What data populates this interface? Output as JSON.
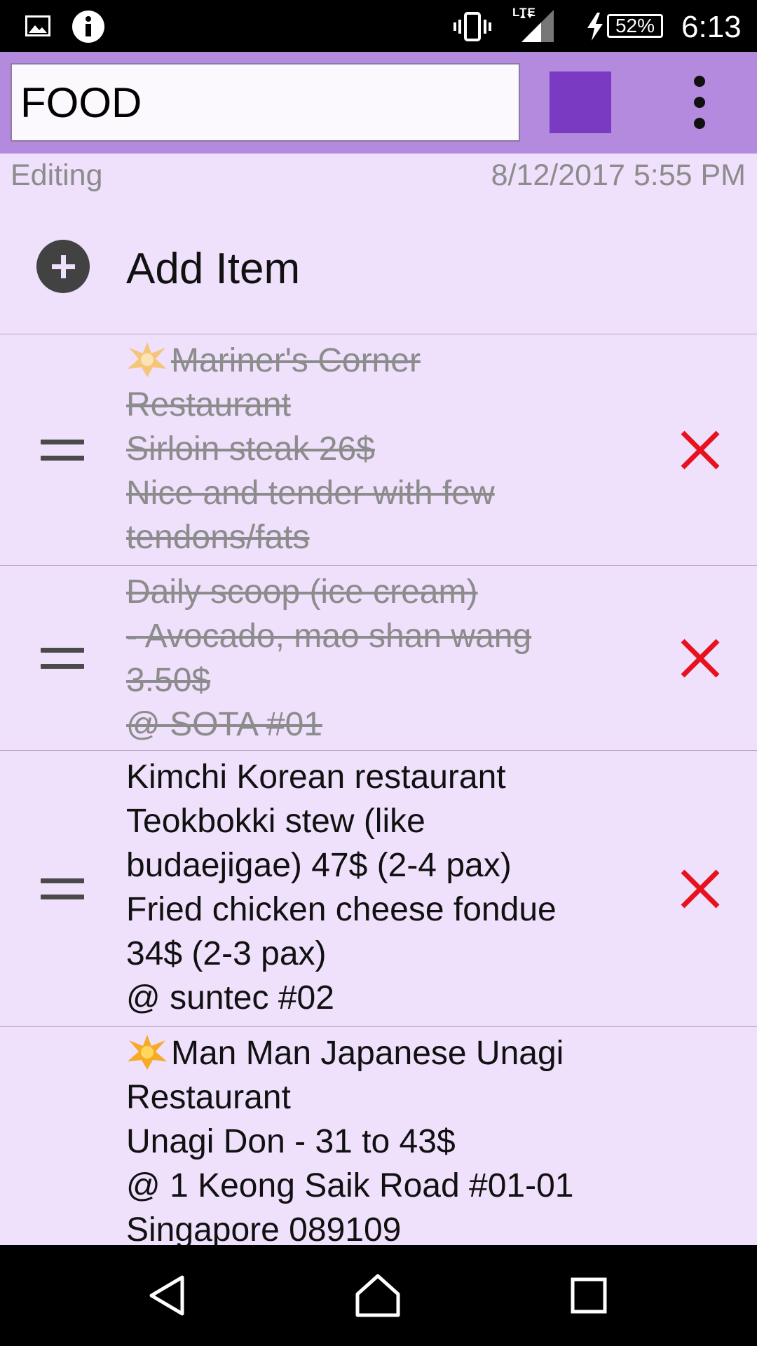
{
  "status_bar": {
    "network": "LTE",
    "battery": "52%",
    "time": "6:13",
    "icons": [
      "gallery-icon",
      "info-icon",
      "vibrate-icon",
      "signal-icon",
      "charging-icon",
      "battery-icon"
    ]
  },
  "toolbar": {
    "title_value": "FOOD",
    "color": "#7b3ac2"
  },
  "meta": {
    "status": "Editing",
    "date": "8/12/2017 5:55 PM"
  },
  "add_item": {
    "label": "Add Item"
  },
  "items": [
    {
      "star": true,
      "done": true,
      "text": "Mariner's Corner\nRestaurant\nSirloin steak 26$\nNice and tender with few\ntendons/fats"
    },
    {
      "star": false,
      "done": true,
      "text": "Daily scoop (ice cream)\n- Avocado, mao shan wang\n3.50$\n@ SOTA #01"
    },
    {
      "star": false,
      "done": false,
      "text": "Kimchi Korean restaurant\nTeokbokki stew (like\nbudaejigae) 47$ (2-4 pax)\nFried chicken cheese fondue\n34$ (2-3 pax)\n@ suntec #02"
    },
    {
      "star": true,
      "done": false,
      "text": "Man Man Japanese Unagi\nRestaurant\nUnagi Don - 31 to 43$\n@ 1 Keong Saik Road #01-01\nSingapore 089109"
    }
  ],
  "colors": {
    "toolbar": "#b38add",
    "background": "#efe0fb",
    "delete": "#e8121f",
    "muted_text": "#8c8c8c"
  }
}
